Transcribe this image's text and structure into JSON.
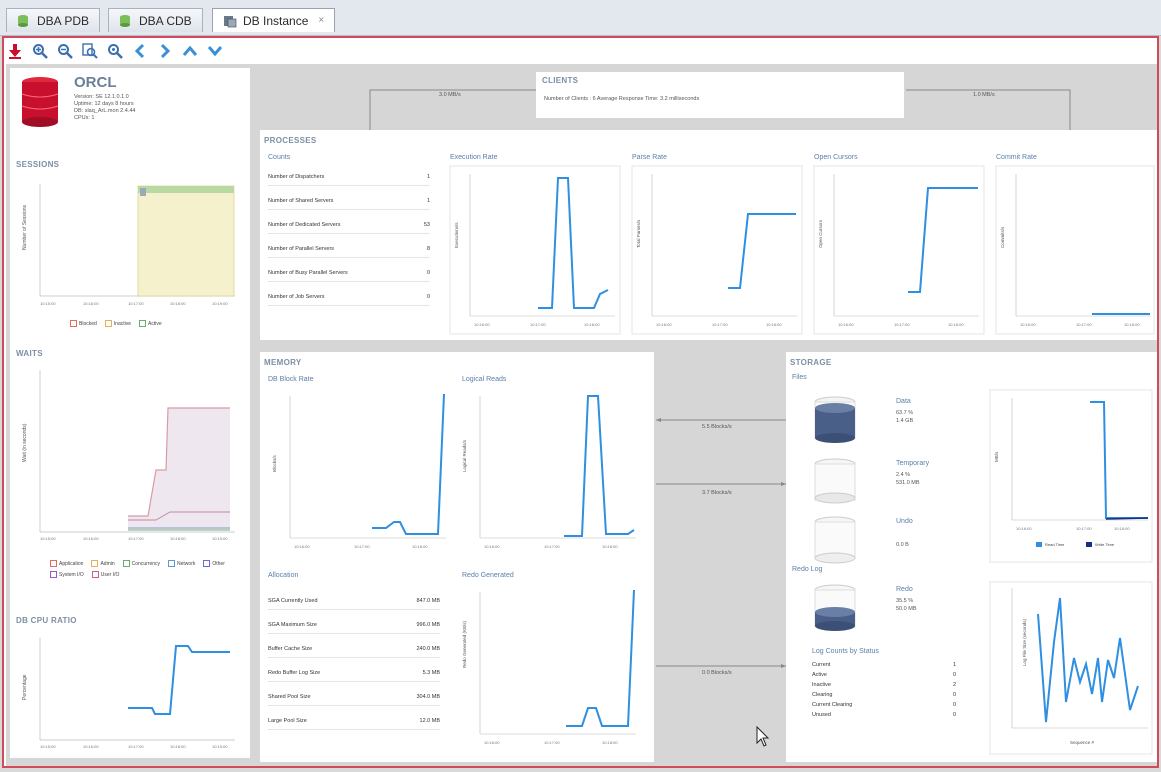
{
  "tabs": [
    {
      "label": "DBA PDB",
      "icon": "database-green-icon"
    },
    {
      "label": "DBA CDB",
      "icon": "database-green-icon"
    },
    {
      "label": "DB Instance",
      "icon": "db-instance-icon",
      "active": true
    }
  ],
  "toolbar": [
    "download-icon",
    "zoom-in-icon",
    "zoom-out-icon",
    "zoom-fit-icon",
    "zoom-reset-icon",
    "back-icon",
    "forward-icon",
    "collapse-icon",
    "expand-icon"
  ],
  "instance": {
    "name": "ORCL",
    "version": "Version: SE 12.1.0.1.0",
    "uptime": "Uptime: 12 days 8 hours",
    "dbinfo": "DB: slaq_ArL.mon 2.4.44",
    "cpus": "CPUs: 1"
  },
  "sessions": {
    "title": "SESSIONS",
    "ylabel": "Number of Sessions",
    "xticks": [
      "10:15:00",
      "10:16:00",
      "10:17:00",
      "10:18:00",
      "10:19:00"
    ],
    "legend": [
      "Blocked",
      "Inactive",
      "Active"
    ]
  },
  "waits": {
    "title": "WAITS",
    "ylabel": "Wait (in seconds)",
    "xticks": [
      "10:15:00",
      "10:16:00",
      "10:17:00",
      "10:18:00",
      "10:19:00"
    ],
    "legend": [
      "Application",
      "Admin",
      "Concurrency",
      "Network",
      "Other",
      "System I/O",
      "User I/O"
    ]
  },
  "dbcpu": {
    "title": "DB CPU RATIO",
    "ylabel": "Percentage",
    "xticks": [
      "10:15:00",
      "10:16:00",
      "10:17:00",
      "10:18:00",
      "10:19:00"
    ]
  },
  "clients": {
    "title": "CLIENTS",
    "summary": "Number of Clients : 6    Average Response Time: 3.2 milliseconds",
    "left_rate": "3.0 MB/s",
    "right_rate": "1.0 MB/s"
  },
  "processes": {
    "title": "PROCESSES",
    "counts_title": "Counts",
    "counts": [
      {
        "label": "Number of Dispatchers",
        "value": "1"
      },
      {
        "label": "Number of Shared Servers",
        "value": "1"
      },
      {
        "label": "Number of Dedicated Servers",
        "value": "53"
      },
      {
        "label": "Number of Parallel Servers",
        "value": "8"
      },
      {
        "label": "Number of Busy Parallel Servers",
        "value": "0"
      },
      {
        "label": "Number of Job Servers",
        "value": "0"
      }
    ],
    "charts": [
      {
        "title": "Execution Rate",
        "ylabel": "Executions/s"
      },
      {
        "title": "Parse Rate",
        "ylabel": "Total Parses/s"
      },
      {
        "title": "Open Cursors",
        "ylabel": "Open Cursors"
      },
      {
        "title": "Commit Rate",
        "ylabel": "Commits/s"
      }
    ],
    "xticks": [
      "10:16:00",
      "10:17:00",
      "10:18:00"
    ]
  },
  "memory": {
    "title": "MEMORY",
    "block_rate_title": "DB Block Rate",
    "block_rate_ylabel": "Blocks/s",
    "logical_reads_title": "Logical Reads",
    "logical_reads_ylabel": "Logical Reads/s",
    "redo_title": "Redo Generated",
    "redo_ylabel": "Redo Generated (KB/s)",
    "allocation_title": "Allocation",
    "allocation": [
      {
        "label": "SGA Currently Used",
        "value": "847.0 MB"
      },
      {
        "label": "SGA Maximum Size",
        "value": "996.0 MB"
      },
      {
        "label": "Buffer Cache Size",
        "value": "240.0 MB"
      },
      {
        "label": "Redo Buffer Log Size",
        "value": "5.3 MB"
      },
      {
        "label": "Shared Pool Size",
        "value": "304.0 MB"
      },
      {
        "label": "Large Pool Size",
        "value": "12.0 MB"
      }
    ],
    "xticks": [
      "10:16:00",
      "10:17:00",
      "10:18:00"
    ]
  },
  "transfer": [
    {
      "label": "5.5 Blocks/s"
    },
    {
      "label": "3.7 Blocks/s"
    },
    {
      "label": "0.0 Blocks/s"
    }
  ],
  "storage": {
    "title": "STORAGE",
    "files_title": "Files",
    "files": [
      {
        "name": "Data",
        "pct": "63.7 %",
        "size": "1.4 GB"
      },
      {
        "name": "Temporary",
        "pct": "2.4 %",
        "size": "531.0 MB"
      },
      {
        "name": "Undo",
        "pct": "",
        "size": "0.0 B"
      }
    ],
    "redo_title": "Redo Log",
    "redo": {
      "name": "Redo",
      "pct": "35.5 %",
      "size": "50.0 MB"
    },
    "log_status_title": "Log Counts by Status",
    "log_status": [
      {
        "label": "Current",
        "value": "1"
      },
      {
        "label": "Active",
        "value": "0"
      },
      {
        "label": "Inactive",
        "value": "2"
      },
      {
        "label": "Clearing",
        "value": "0"
      },
      {
        "label": "Current Clearing",
        "value": "0"
      },
      {
        "label": "Unused",
        "value": "0"
      }
    ],
    "io_ylabel": "MB/s",
    "io_xticks": [
      "10:16:00",
      "10:17:00",
      "10:18:00"
    ],
    "io_legend": [
      "Read Time",
      "Write Time"
    ],
    "log_ylabel": "Log File Size (seconds)",
    "log_xlabel": "Sequence #"
  },
  "colors": {
    "accent": "#2f8fe0",
    "border_red": "#d24b5b",
    "title": "#7d8fa6",
    "subtitle": "#5a7fa8",
    "db_red": "#c8102e",
    "sessions_fill": "#f5f1cc",
    "sessions_green": "#b9d9a0",
    "waits_line": "#e0a0a8"
  }
}
